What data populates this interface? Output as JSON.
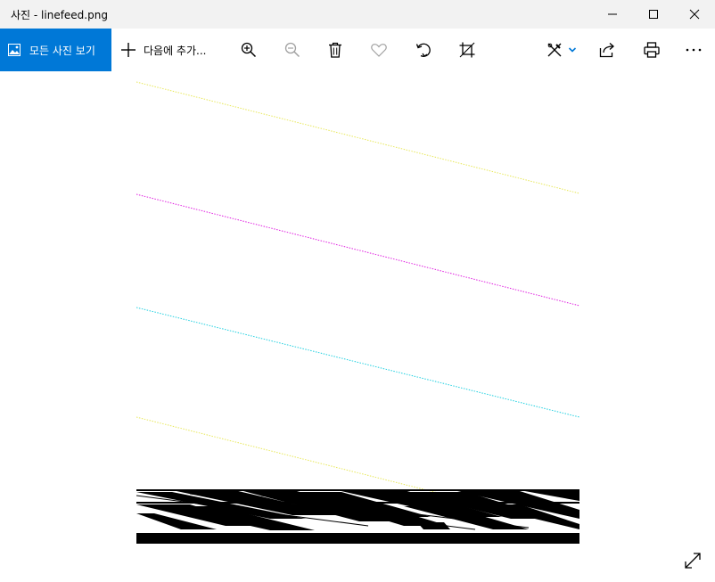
{
  "window": {
    "title": "사진 - linefeed.png"
  },
  "titlebar_buttons": {
    "minimize": "minimize-icon",
    "maximize": "maximize-icon",
    "close": "close-icon"
  },
  "toolbar": {
    "all_photos_label": "모든 사진 보기",
    "add_to_label": "다음에 추가...",
    "icons": [
      "zoom-in-icon",
      "zoom-out-icon",
      "delete-icon",
      "favorite-icon",
      "rotate-icon",
      "crop-icon",
      "edit-icon",
      "share-icon",
      "print-icon",
      "more-icon"
    ]
  },
  "colors": {
    "accent": "#0078d7",
    "titlebar_bg": "#f2f2f2",
    "line_yellow": "#e8e85a",
    "line_magenta": "#e020e0",
    "line_cyan": "#20d0e0"
  }
}
